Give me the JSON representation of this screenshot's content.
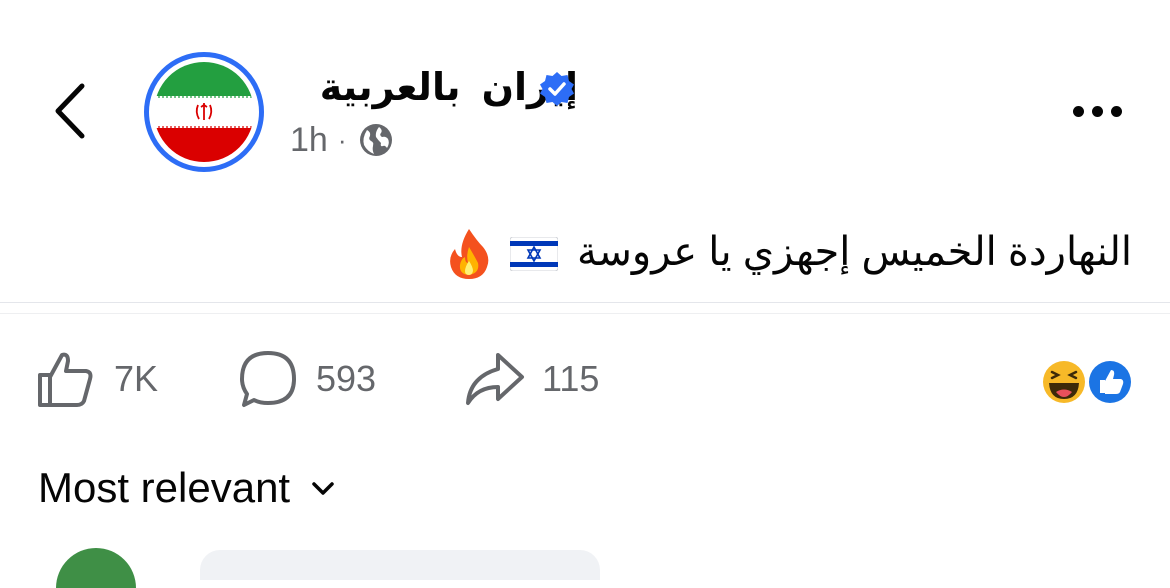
{
  "header": {
    "page_name": "إيران  بالعربية",
    "verified": true,
    "time": "1h",
    "separator": "·",
    "audience_icon": "globe-icon",
    "back_icon": "chevron-left-icon",
    "more_icon": "more-horizontal-icon"
  },
  "post": {
    "text": "النهاردة الخميس إجهزي يا عروسة",
    "emojis": [
      "flag-israel-emoji",
      "fire-emoji"
    ]
  },
  "actions": {
    "like_count": "7K",
    "comment_count": "593",
    "share_count": "115"
  },
  "reactions": [
    "like-reaction",
    "haha-reaction"
  ],
  "comments": {
    "sort_label": "Most relevant"
  },
  "colors": {
    "accent_blue": "#2d6df6",
    "muted_text": "#65676b",
    "divider": "#e4e6eb",
    "flag_green": "#239f40",
    "flag_red": "#da0000"
  }
}
